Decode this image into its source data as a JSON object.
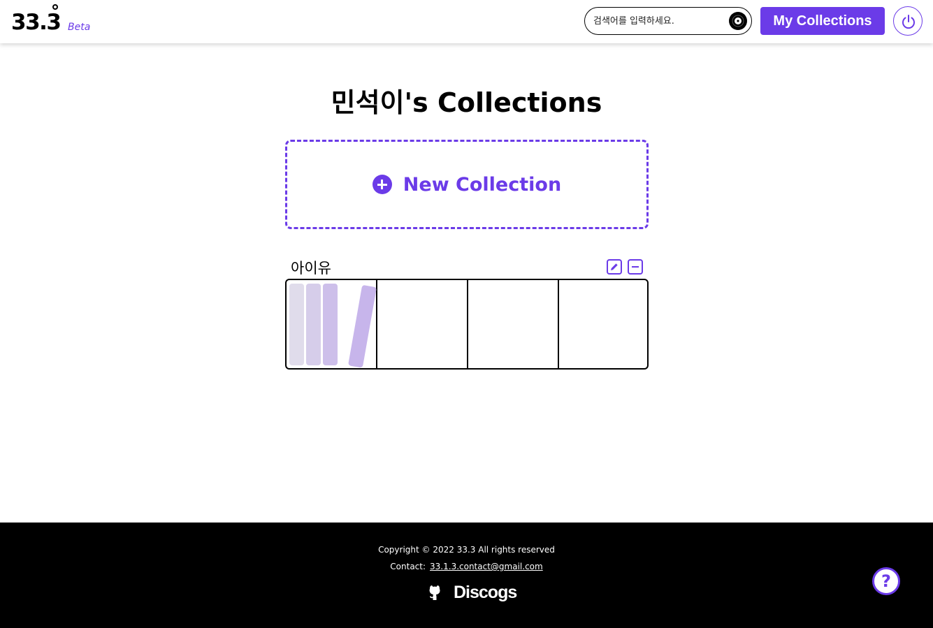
{
  "header": {
    "logo_text": "33.3",
    "logo_badge": "Beta",
    "search_placeholder": "검색어를 입력하세요.",
    "my_collections_label": "My Collections"
  },
  "main": {
    "page_title": "민석이's Collections",
    "new_collection_label": "New Collection",
    "collections": [
      {
        "name": "아이유"
      }
    ]
  },
  "footer": {
    "copyright": "Copyright © 2022 33.3 All rights reserved",
    "contact_label": "Contact:",
    "contact_email": "33.1.3.contact@gmail.com",
    "discogs_label": "Discogs"
  },
  "help_label": "?",
  "colors": {
    "accent": "#6b3be8",
    "book_light": "#e0dceb",
    "book_mid": "#d2c6ea",
    "book_dark": "#c7b5eb"
  }
}
